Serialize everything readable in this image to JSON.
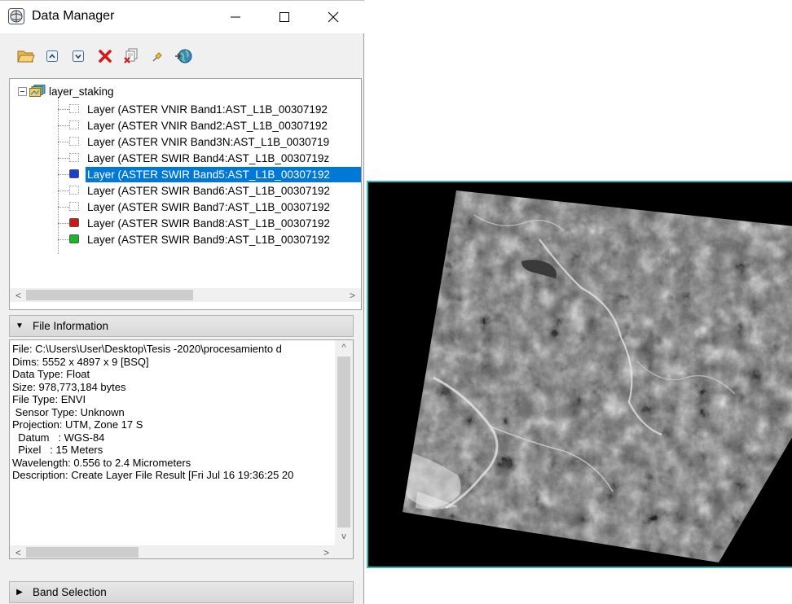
{
  "window": {
    "title": "Data Manager",
    "minimize_glyph": "—",
    "maximize_glyph": "☐",
    "close_glyph": "✕"
  },
  "toolbar": {
    "items": [
      {
        "name": "open-file-button",
        "icon": "folder-open-icon"
      },
      {
        "name": "expand-all-button",
        "icon": "chevron-up-box-icon"
      },
      {
        "name": "collapse-all-button",
        "icon": "chevron-down-box-icon"
      },
      {
        "name": "close-file-button",
        "icon": "red-x-icon"
      },
      {
        "name": "close-all-button",
        "icon": "close-all-files-icon"
      },
      {
        "name": "pin-button",
        "icon": "pin-icon"
      },
      {
        "name": "refresh-button",
        "icon": "globe-refresh-icon"
      }
    ]
  },
  "tree": {
    "root_label": "layer_staking",
    "rows": [
      {
        "label": "Layer (ASTER VNIR Band1:AST_L1B_00307192",
        "swatch": "none",
        "selected": false
      },
      {
        "label": "Layer (ASTER VNIR Band2:AST_L1B_00307192",
        "swatch": "none",
        "selected": false
      },
      {
        "label": "Layer (ASTER VNIR Band3N:AST_L1B_0030719",
        "swatch": "none",
        "selected": false
      },
      {
        "label": "Layer (ASTER SWIR Band4:AST_L1B_0030719z",
        "swatch": "none",
        "selected": false
      },
      {
        "label": "Layer (ASTER SWIR Band5:AST_L1B_00307192",
        "swatch": "blue",
        "selected": true
      },
      {
        "label": "Layer (ASTER SWIR Band6:AST_L1B_00307192",
        "swatch": "none",
        "selected": false
      },
      {
        "label": "Layer (ASTER SWIR Band7:AST_L1B_00307192",
        "swatch": "none",
        "selected": false
      },
      {
        "label": "Layer (ASTER SWIR Band8:AST_L1B_00307192",
        "swatch": "red",
        "selected": false
      },
      {
        "label": "Layer (ASTER SWIR Band9:AST_L1B_00307192",
        "swatch": "green",
        "selected": false
      }
    ],
    "scroll_left": "<",
    "scroll_right": ">"
  },
  "file_info": {
    "header": "File Information",
    "lines": [
      "File: C:\\Users\\User\\Desktop\\Tesis -2020\\procesamiento d",
      "Dims: 5552 x 4897 x 9 [BSQ]",
      "Data Type: Float",
      "Size: 978,773,184 bytes",
      "File Type: ENVI",
      " Sensor Type: Unknown",
      "Projection: UTM, Zone 17 S",
      "  Datum   : WGS-84",
      "  Pixel   : 15 Meters",
      "Wavelength: 0.556 to 2.4 Micrometers",
      "Description: Create Layer File Result [Fri Jul 16 19:36:25 20"
    ],
    "scroll_up": "^",
    "scroll_down": "v",
    "scroll_left": "<",
    "scroll_right": ">"
  },
  "band_selection": {
    "header": "Band Selection"
  },
  "colors": {
    "selection": "#0078d7",
    "swatch_blue": "#1a3fd6",
    "swatch_red": "#d01818",
    "swatch_green": "#18b828",
    "view_border": "#2bb8b8"
  }
}
